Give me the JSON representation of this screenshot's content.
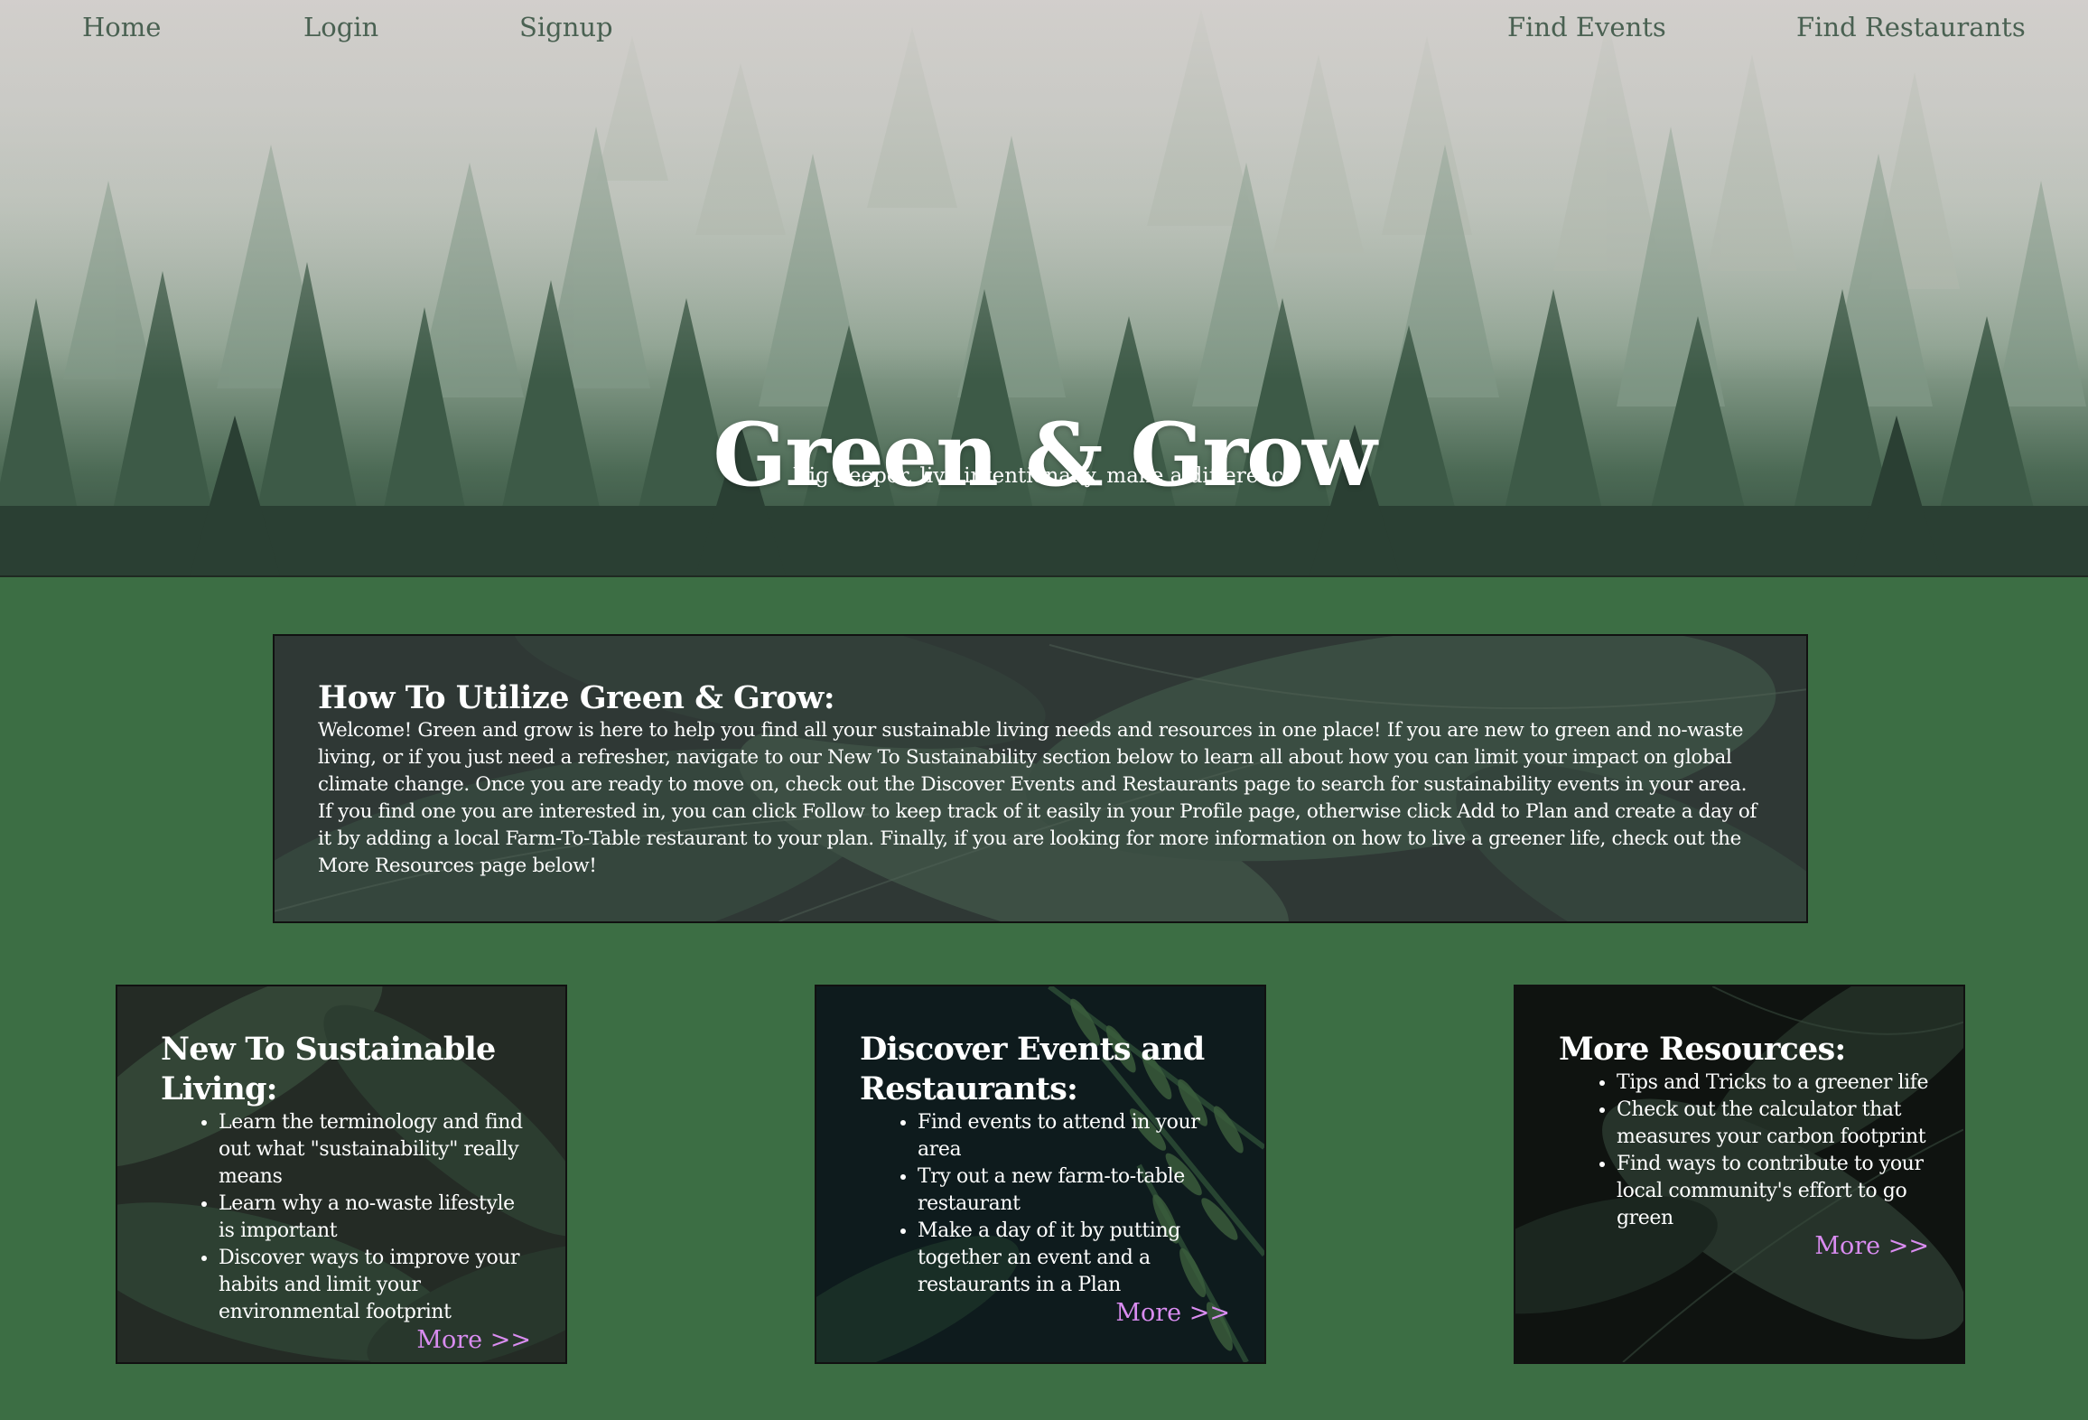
{
  "nav": {
    "home": "Home",
    "login": "Login",
    "signup": "Signup",
    "find_events": "Find Events",
    "find_restaurants": "Find Restaurants"
  },
  "hero": {
    "title": "Green & Grow",
    "subtitle": "Dig deeper, live intentionally, make a difference"
  },
  "intro": {
    "title": "How To Utilize Green & Grow:",
    "body": "Welcome! Green and grow is here to help you find all your sustainable living needs and resources in one place! If you are new to green and no-waste living, or if you just need a refresher, navigate to our New To Sustainability section below to learn all about how you can limit your impact on global climate change. Once you are ready to move on, check out the Discover Events and Restaurants page to search for sustainability events in your area. If you find one you are interested in, you can click Follow to keep track of it easily in your Profile page, otherwise click Add to Plan and create a day of it by adding a local Farm-To-Table restaurant to your plan. Finally, if you are looking for more information on how to live a greener life, check out the More Resources page below!"
  },
  "cards": [
    {
      "title": "New To Sustainable Living:",
      "items": [
        "Learn the terminology and find out what \"sustainability\" really means",
        "Learn why a no-waste lifestyle is important",
        "Discover ways to improve your habits and limit your environmental footprint"
      ],
      "more": "More >>"
    },
    {
      "title": "Discover Events and Restaurants:",
      "items": [
        "Find events to attend in your area",
        "Try out a new farm-to-table restaurant",
        "Make a day of it by putting together an event and a restaurants in a Plan"
      ],
      "more": "More >>"
    },
    {
      "title": "More Resources:",
      "items": [
        "Tips and Tricks to a greener life",
        "Check out the calculator that measures your carbon footprint",
        "Find ways to contribute to your local community's effort to go green"
      ],
      "more": "More >>"
    }
  ],
  "colors": {
    "page_background": "#3c6e44",
    "nav_text": "#4a6152",
    "more_link": "#d98cf0",
    "heading_text": "#ffffff"
  }
}
